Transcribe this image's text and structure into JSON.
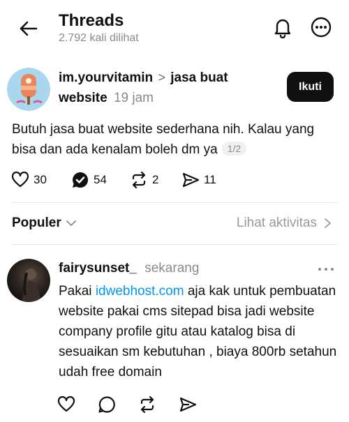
{
  "header": {
    "title": "Threads",
    "views": "2.792 kali dilihat"
  },
  "post": {
    "username": "im.yourvitamin",
    "topic_chevron": ">",
    "topic_line1": "jasa buat",
    "topic_line2": "website",
    "time": "19 jam",
    "follow_label": "Ikuti",
    "text": "Butuh jasa buat website sederhana nih. Kalau yang bisa dan ada kenalam boleh dm ya",
    "page_indicator": "1/2",
    "likes": "30",
    "replies": "54",
    "reposts": "2",
    "shares": "11"
  },
  "sort": {
    "label": "Populer",
    "activity": "Lihat aktivitas"
  },
  "reply": {
    "username": "fairysunset_",
    "time": "sekarang",
    "text_before": "Pakai ",
    "link": "idwebhost.com",
    "text_after": " aja kak untuk pembuatan website pakai cms sitepad bisa jadi website company profile gitu atau katalog bisa di sesuaikan sm kebutuhan , biaya 800rb setahun udah free domain"
  },
  "colors": {
    "text": "#101010",
    "muted": "#8a8a8a",
    "link": "#0095f6",
    "follow_bg": "#101010"
  },
  "icons": [
    "back-arrow-icon",
    "bell-icon",
    "more-circle-icon",
    "heart-icon",
    "reply-check-icon",
    "repost-icon",
    "share-icon",
    "chevron-down-icon",
    "chevron-right-icon",
    "comment-icon",
    "more-dots-icon"
  ]
}
